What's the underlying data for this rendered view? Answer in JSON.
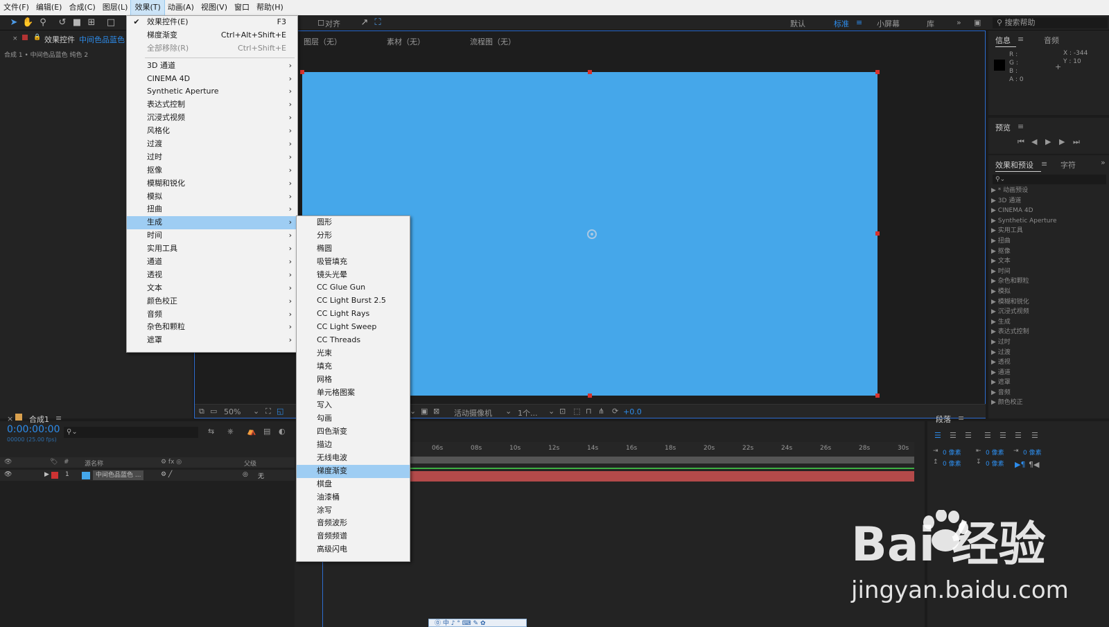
{
  "menubar": {
    "items": [
      "文件(F)",
      "编辑(E)",
      "合成(C)",
      "图层(L)",
      "效果(T)",
      "动画(A)",
      "视图(V)",
      "窗口",
      "帮助(H)"
    ],
    "active_index": 4
  },
  "toolbar": {
    "align_label": "对齐",
    "workspaces": [
      "默认",
      "标准",
      "小屏幕",
      "库"
    ],
    "active_workspace": "标准",
    "search_placeholder": "搜索帮助"
  },
  "left_panel": {
    "tab_label": "效果控件",
    "tab_layer": "中间色品蓝色",
    "breadcrumb": "合成 1 • 中间色品蓝色 纯色 2"
  },
  "viewer_tabs": {
    "layer": "图层（无）",
    "footage": "素材（无）",
    "flowchart": "流程图（无）"
  },
  "viewer_bar": {
    "zoom": "50%",
    "camera": "活动摄像机",
    "views": "1个...",
    "exposure": "+0.0"
  },
  "info": {
    "tab": "信息",
    "tab2": "音频",
    "r": "R :",
    "g": "G :",
    "b": "B :",
    "a": "A : 0",
    "x": "X : -344",
    "y": "Y : 10",
    "swatch_color": "#000000"
  },
  "preview": {
    "tab": "预览"
  },
  "effects_presets": {
    "tab": "效果和预设",
    "tab2": "字符",
    "tree": [
      "* 动画预设",
      "3D 通道",
      "CINEMA 4D",
      "Synthetic Aperture",
      "实用工具",
      "扭曲",
      "抠像",
      "文本",
      "时间",
      "杂色和颗粒",
      "模拟",
      "模糊和锐化",
      "沉浸式视频",
      "生成",
      "表达式控制",
      "过时",
      "过渡",
      "透视",
      "通道",
      "遮罩",
      "音频",
      "颜色校正"
    ]
  },
  "timeline": {
    "tab": "合成1",
    "timecode": "0:00:00:00",
    "fps_note": "00000 (25.00 fps)",
    "col_source": "源名称",
    "col_parent": "父级",
    "row_index": "1",
    "row_name": "中间色品蓝色 ...",
    "row_parent": "无",
    "ruler_ticks": [
      "06s",
      "08s",
      "10s",
      "12s",
      "14s",
      "16s",
      "18s",
      "20s",
      "22s",
      "24s",
      "26s",
      "28s",
      "30s"
    ]
  },
  "paragraph": {
    "tab": "段落",
    "fields": [
      "0 像素",
      "0 像素",
      "0 像素",
      "0 像素",
      "0 像素"
    ]
  },
  "effects_menu": {
    "top_items": [
      {
        "label": "效果控件(E)",
        "shortcut": "F3",
        "checked": true
      },
      {
        "label": "梯度渐变",
        "shortcut": "Ctrl+Alt+Shift+E"
      },
      {
        "label": "全部移除(R)",
        "shortcut": "Ctrl+Shift+E",
        "disabled": true
      }
    ],
    "categories": [
      "3D 通道",
      "CINEMA 4D",
      "Synthetic Aperture",
      "表达式控制",
      "沉浸式视频",
      "风格化",
      "过渡",
      "过时",
      "抠像",
      "模糊和锐化",
      "模拟",
      "扭曲",
      "生成",
      "时间",
      "实用工具",
      "通道",
      "透视",
      "文本",
      "颜色校正",
      "音频",
      "杂色和颗粒",
      "遮罩"
    ],
    "highlighted": "生成"
  },
  "generate_menu": {
    "items": [
      "圆形",
      "分形",
      "椭圆",
      "吸管填充",
      "镜头光晕",
      "CC Glue Gun",
      "CC Light Burst 2.5",
      "CC Light Rays",
      "CC Light Sweep",
      "CC Threads",
      "光束",
      "填充",
      "网格",
      "单元格图案",
      "写入",
      "勾画",
      "四色渐变",
      "描边",
      "无线电波",
      "梯度渐变",
      "棋盘",
      "油漆桶",
      "涂写",
      "音频波形",
      "音频频谱",
      "高级闪电"
    ],
    "highlighted": "梯度渐变"
  },
  "watermark": {
    "logo": "Bai  经验",
    "url": "jingyan.baidu.com"
  },
  "colors": {
    "canvas": "#45a7ea",
    "accent": "#2d8ceb",
    "menu_highlight": "#9ecdf3",
    "layer_bar": "#b44a4a"
  }
}
